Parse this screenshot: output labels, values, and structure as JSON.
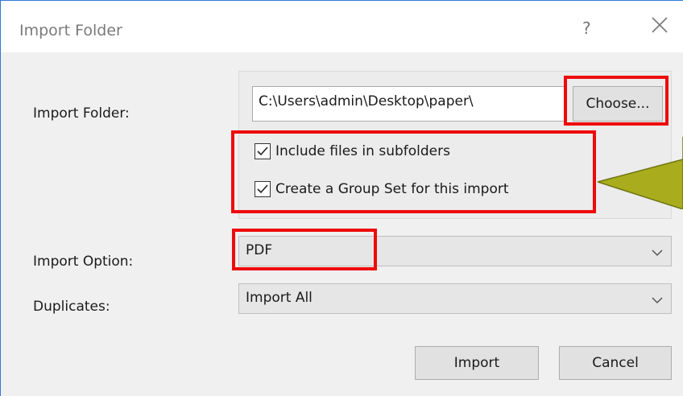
{
  "window": {
    "title": "Import Folder",
    "help_glyph": "?",
    "close_icon": "close-icon"
  },
  "folder": {
    "label": "Import Folder:",
    "path": "C:\\Users\\admin\\Desktop\\paper\\",
    "choose_label": "Choose..."
  },
  "options": {
    "include_subfolders": {
      "label": "Include files in subfolders",
      "checked": true
    },
    "create_group_set": {
      "label": "Create a Group Set for this import",
      "checked": true
    }
  },
  "import_option": {
    "label": "Import Option:",
    "value": "PDF"
  },
  "duplicates": {
    "label": "Duplicates:",
    "value": "Import All"
  },
  "buttons": {
    "import": "Import",
    "cancel": "Cancel"
  },
  "annotation": {
    "highlight_color": "#ee0b0b",
    "callout_color": "#a9ad1d"
  }
}
